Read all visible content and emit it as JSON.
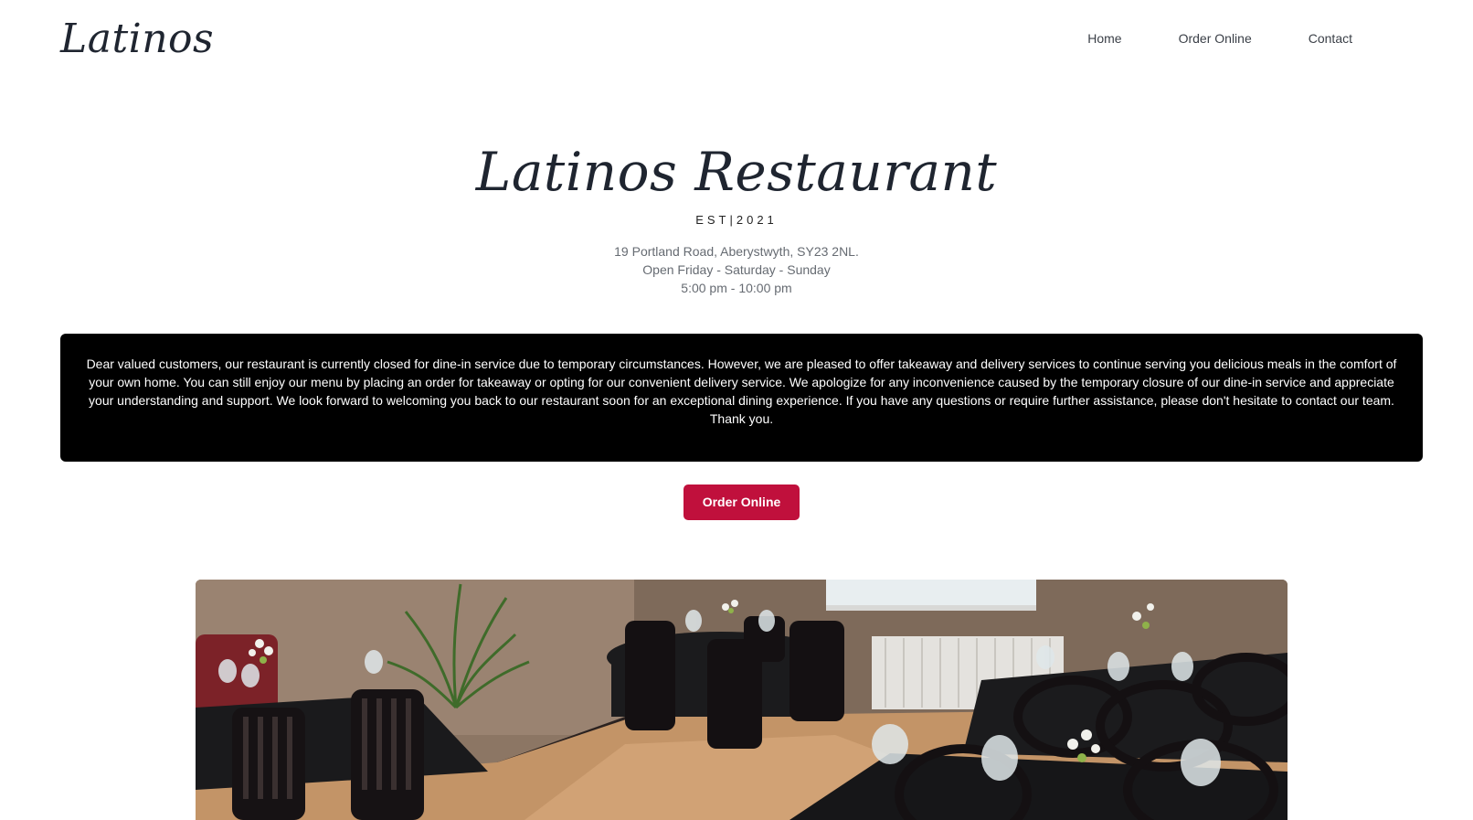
{
  "header": {
    "logo": "Latinos",
    "nav": [
      {
        "label": "Home"
      },
      {
        "label": "Order Online"
      },
      {
        "label": "Contact"
      }
    ]
  },
  "hero": {
    "title": "Latinos Restaurant",
    "established": "EST|2021",
    "address": "19 Portland Road, Aberystwyth, SY23 2NL.",
    "open_days": "Open Friday - Saturday - Sunday",
    "hours": "5:00 pm - 10:00 pm"
  },
  "notice": {
    "text": "Dear valued customers, our restaurant is currently closed for dine-in service due to temporary circumstances. However, we are pleased to offer takeaway and delivery services to continue serving you delicious meals in the comfort of your own home. You can still enjoy our menu by placing an order for takeaway or opting for our convenient delivery service. We apologize for any inconvenience caused by the temporary closure of our dine-in service and appreciate your understanding and support. We look forward to welcoming you back to our restaurant soon for an exceptional dining experience. If you have any questions or require further assistance, please don't hesitate to contact our team. Thank you."
  },
  "cta": {
    "label": "Order Online",
    "color": "#c0103c"
  },
  "colors": {
    "notice_bg": "#000000",
    "text_dark": "#1f2530",
    "text_muted": "#666b72"
  }
}
